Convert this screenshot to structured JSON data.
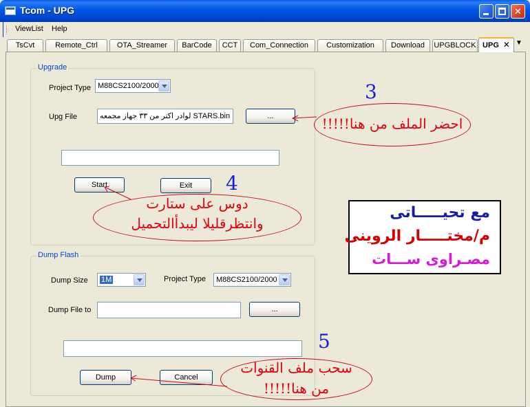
{
  "window": {
    "title": "Tcom - UPG"
  },
  "menu": [
    "ViewList",
    "Help"
  ],
  "tabs": [
    {
      "label": "TsCvt"
    },
    {
      "label": "Remote_Ctrl"
    },
    {
      "label": "OTA_Streamer"
    },
    {
      "label": "BarCode"
    },
    {
      "label": "CCT"
    },
    {
      "label": "Com_Connection"
    },
    {
      "label": "Customization"
    },
    {
      "label": "Download"
    },
    {
      "label": "UPGBLOCK"
    },
    {
      "label": "UPG"
    }
  ],
  "active_tab": "UPG",
  "upgrade": {
    "title": "Upgrade",
    "project_type_label": "Project Type",
    "project_type_value": "M88CS2100/2000",
    "upg_file_label": "Upg File",
    "upg_file_value": "STARS.bin لوادر اكتر من ٣٣ جهاز مجمعه",
    "browse_label": "...",
    "progress_value": "",
    "start_label": "Start",
    "exit_label": "Exit"
  },
  "dump": {
    "title": "Dump Flash",
    "dump_size_label": "Dump Size",
    "dump_size_value": "1M",
    "project_type_label": "Project Type",
    "project_type_value": "M88CS2100/2000",
    "dump_file_label": "Dump File to",
    "dump_file_value": "",
    "browse_label": "...",
    "progress_value": "",
    "dump_label": "Dump",
    "cancel_label": "Cancel"
  },
  "annotations": {
    "step3": {
      "number": "3",
      "text": "احضر الملف من هنا!!!!!"
    },
    "step4": {
      "number": "4",
      "line1": "دوس على ستارت",
      "line2": "وانتظرقليلا ليبدأالتحميل"
    },
    "step5": {
      "number": "5",
      "line1": "سحب ملف القنوات",
      "line2": "من هنا!!!!!"
    }
  },
  "credit": {
    "line1": "مع تحيـــــاتى",
    "line2": "م/مختـــــار الروينى",
    "line3": "مصـراوى ســـات"
  },
  "colors": {
    "annotation_red": "#e3000f",
    "step_blue": "#1820d8",
    "credit_blue": "#1a1aa8",
    "credit_red": "#d40000",
    "credit_magenta": "#d61ad6"
  }
}
